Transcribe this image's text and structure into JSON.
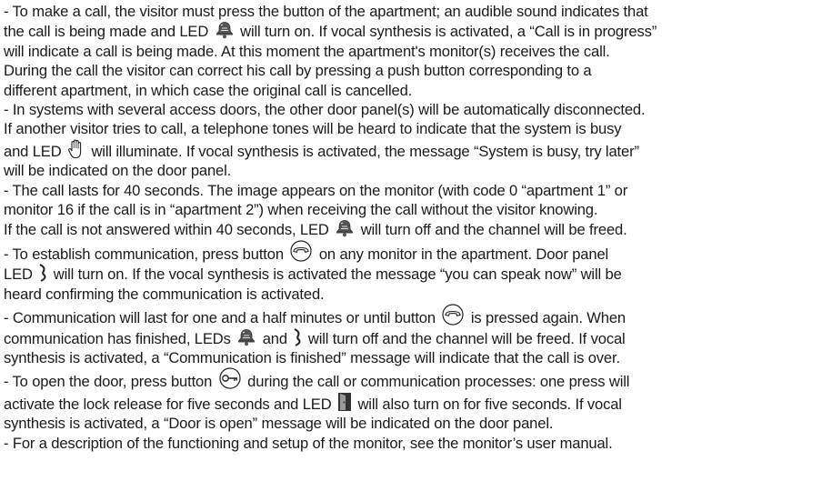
{
  "paragraphs": [
    {
      "lines": [
        [
          "- To make a call, the visitor must press the button of the apartment; an audible sound indicates that"
        ],
        [
          "the call is being made and LED ",
          "{bell-icon}",
          " will turn on. If vocal synthesis is activated, a “Call is in progress”"
        ],
        [
          "will indicate a call is being made. At this moment the apartment's monitor(s) receives the call."
        ],
        [
          "During the call the visitor can correct his call by pressing a push button corresponding to a"
        ],
        [
          "different apartment, in which case the original call is cancelled."
        ]
      ]
    },
    {
      "lines": [
        [
          "- In systems with several access doors, the other door panel(s) will be automatically disconnected."
        ],
        [
          "If another visitor tries to call, a telephone tones will be heard to indicate that the system is busy"
        ],
        [
          "and LED ",
          "{hand-icon}",
          " will illuminate. If vocal synthesis is activated, the message “System is busy, try later”"
        ],
        [
          "will be indicated on the door panel."
        ]
      ]
    },
    {
      "lines": [
        [
          "- The call lasts for 40 seconds. The image appears on the monitor (with code 0 “apartment 1” or"
        ],
        [
          "monitor 16 if the call is in “apartment 2”) when receiving the call without the visitor knowing."
        ],
        [
          "If the call is not answered within 40 seconds, LED ",
          "{bell-icon}",
          " will turn off and the channel will be freed."
        ]
      ]
    },
    {
      "lines": [
        [
          "- To establish communication, press button ",
          "{handset-button-icon}",
          " on any monitor in the apartment. Door panel"
        ],
        [
          "LED ",
          "{speech-icon}",
          " will turn on.  If the vocal synthesis is activated the message “you can speak now” will be"
        ],
        [
          "heard confirming the communication is activated."
        ]
      ]
    },
    {
      "lines": [
        [
          "- Communication will last for one and a half minutes or until button",
          "{handset-button-icon}",
          "is pressed again. When"
        ],
        [
          "communication has finished, LEDs ",
          "{bell-icon}",
          " and ",
          "{speech-icon}",
          " will turn off and the channel will be freed. If vocal"
        ],
        [
          "synthesis is activated, a “Communication is finished” message will indicate that the call is over."
        ]
      ]
    },
    {
      "lines": [
        [
          "- To open the door, press button",
          "{key-button-icon}",
          "during the call or communication processes: one press will"
        ],
        [
          "activate the lock release for five seconds and LED ",
          "{door-icon}",
          " will also turn on for five seconds. If vocal"
        ],
        [
          "synthesis is activated, a “Door is open” message will be indicated on the door panel."
        ]
      ]
    },
    {
      "lines": [
        [
          "- For a description of the functioning and setup of the monitor, see the monitor’s user manual."
        ]
      ]
    }
  ]
}
